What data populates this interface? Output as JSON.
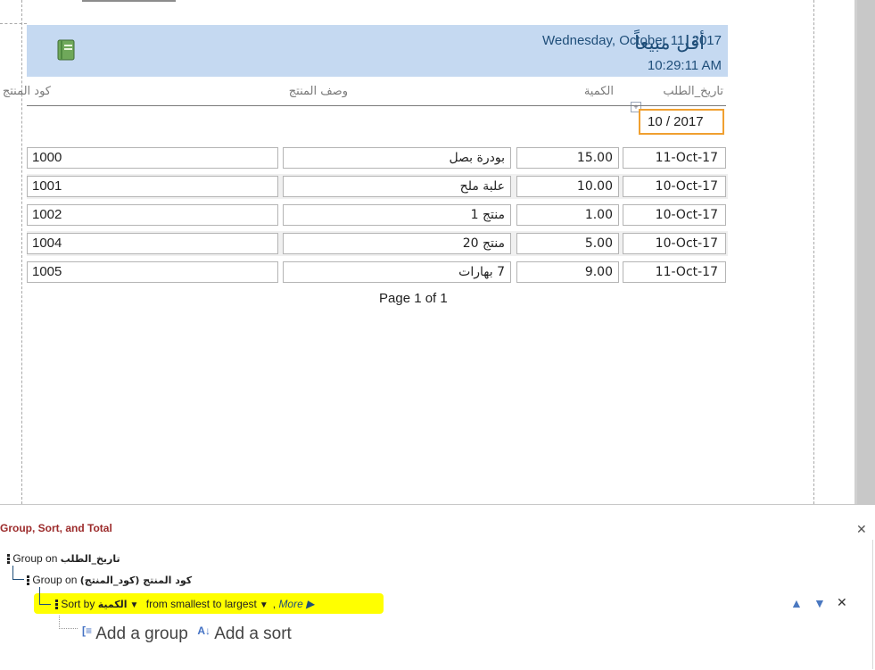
{
  "report": {
    "title": "أقل مبيعاً",
    "date": "Wednesday, October 11, 2017",
    "time": "10:29:11 AM",
    "column_headers": {
      "date": "تاريخ_الطلب",
      "quantity": "الكمية",
      "description": "وصف المنتج",
      "code": "كود المنتج"
    },
    "group_header_value": "10 / 2017",
    "rows": [
      {
        "code": "1000",
        "description": "بودرة بصل",
        "quantity": "15.00",
        "date": "11-Oct-17"
      },
      {
        "code": "1001",
        "description": "علبة ملح",
        "quantity": "10.00",
        "date": "10-Oct-17"
      },
      {
        "code": "1002",
        "description": "منتج 1",
        "quantity": "1.00",
        "date": "10-Oct-17"
      },
      {
        "code": "1004",
        "description": "منتج 20",
        "quantity": "5.00",
        "date": "10-Oct-17"
      },
      {
        "code": "1005",
        "description": "7 بهارات",
        "quantity": "9.00",
        "date": "11-Oct-17"
      }
    ],
    "footer": "Page 1 of 1",
    "colors": {
      "header_band": "#c5d9f1",
      "alt_row": "#f0f0f0",
      "title": "#1f4e79",
      "group_box_border": "#f0a030"
    }
  },
  "panel": {
    "title": "Group, Sort, and Total",
    "close_icon": "close-icon",
    "group1": {
      "prefix": "Group on",
      "field": "تاريخ_الطلب"
    },
    "group2": {
      "prefix": "Group on",
      "field": "كود المنتج (كود_المنتج)"
    },
    "sort": {
      "prefix": "Sort by",
      "field": "الكمية",
      "order": "from smallest to largest",
      "separator": ",",
      "more": "More ▶"
    },
    "add_group": "Add a group",
    "add_sort": "Add a sort",
    "highlight_color": "#ffff00"
  }
}
